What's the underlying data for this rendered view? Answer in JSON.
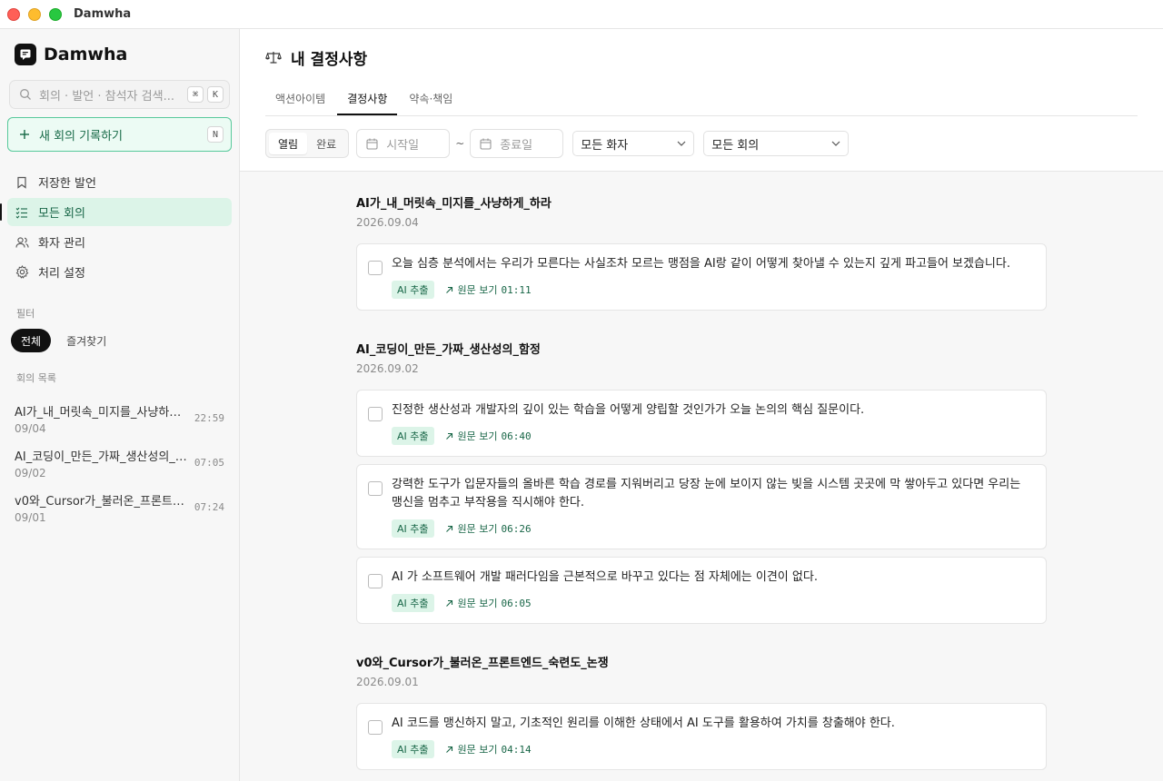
{
  "window": {
    "title": "Damwha"
  },
  "sidebar": {
    "brand": "Damwha",
    "search": {
      "placeholder": "회의 · 발언 · 참석자 검색...",
      "kbd1": "⌘",
      "kbd2": "K"
    },
    "new_button": {
      "label": "새 회의 기록하기",
      "shortcut": "N"
    },
    "nav": [
      {
        "label": "저장한 발언",
        "icon": "bookmark-icon"
      },
      {
        "label": "모든 회의",
        "icon": "list-check-icon",
        "active": true
      },
      {
        "label": "화자 관리",
        "icon": "users-icon"
      },
      {
        "label": "처리 설정",
        "icon": "gear-icon"
      }
    ],
    "filter_label": "필터",
    "filters": [
      "전체",
      "즐겨찾기"
    ],
    "meetings_label": "회의 목록",
    "meetings": [
      {
        "title": "AI가_내_머릿속_미지를_사냥하게_하라",
        "date": "09/04",
        "time": "22:59"
      },
      {
        "title": "AI_코딩이_만든_가짜_생산성의_함정",
        "date": "09/02",
        "time": "07:05"
      },
      {
        "title": "v0와_Cursor가_불러온_프론트엔드_숙련도_논쟁",
        "date": "09/01",
        "time": "07:24"
      }
    ]
  },
  "main": {
    "title": "내 결정사항",
    "tabs": [
      "액션아이템",
      "결정사항",
      "약속·책임"
    ],
    "active_tab": 1,
    "toolbar": {
      "status": [
        "열림",
        "완료"
      ],
      "start_placeholder": "시작일",
      "tilde": "~",
      "end_placeholder": "종료일",
      "speaker": "모든 화자",
      "meeting": "모든 회의"
    },
    "badge_label": "AI 추출",
    "link_label": "원문 보기",
    "groups": [
      {
        "title": "AI가_내_머릿속_미지를_사냥하게_하라",
        "date": "2026.09.04",
        "items": [
          {
            "text": "오늘 심층 분석에서는 우리가 모른다는 사실조차 모르는 맹점을 AI랑 같이 어떻게 찾아낼 수 있는지 깊게 파고들어 보겠습니다.",
            "time": "01:11"
          }
        ]
      },
      {
        "title": "AI_코딩이_만든_가짜_생산성의_함정",
        "date": "2026.09.02",
        "items": [
          {
            "text": "진정한 생산성과 개발자의 깊이 있는 학습을 어떻게 양립할 것인가가 오늘 논의의 핵심 질문이다.",
            "time": "06:40"
          },
          {
            "text": "강력한 도구가 입문자들의 올바른 학습 경로를 지워버리고 당장 눈에 보이지 않는 빚을 시스템 곳곳에 막 쌓아두고 있다면 우리는 맹신을 멈추고 부작용을 직시해야 한다.",
            "time": "06:26"
          },
          {
            "text": "AI 가 소프트웨어 개발 패러다임을 근본적으로 바꾸고 있다는 점 자체에는 이견이 없다.",
            "time": "06:05"
          }
        ]
      },
      {
        "title": "v0와_Cursor가_불러온_프론트엔드_숙련도_논쟁",
        "date": "2026.09.01",
        "items": [
          {
            "text": "AI 코드를 맹신하지 말고, 기초적인 원리를 이해한 상태에서 AI 도구를 활용하여 가치를 창출해야 한다.",
            "time": "04:14"
          }
        ]
      }
    ]
  }
}
